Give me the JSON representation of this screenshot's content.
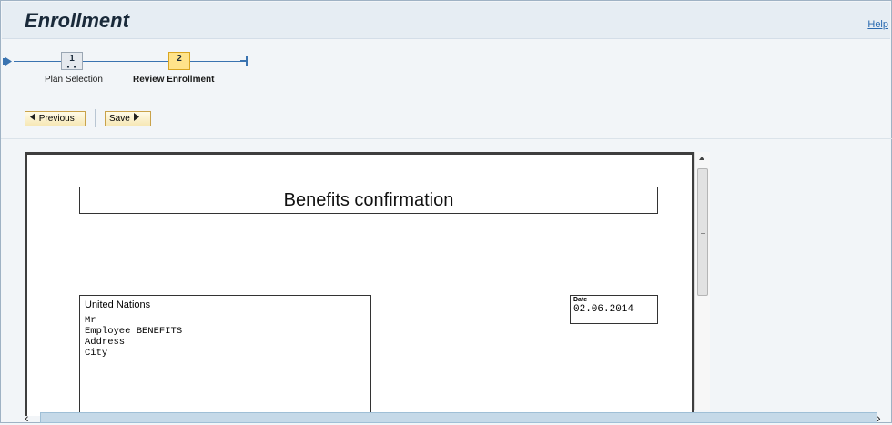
{
  "page": {
    "title": "Enrollment",
    "help_link": "Help"
  },
  "roadmap": {
    "steps": [
      {
        "number": "1",
        "label": "Plan Selection",
        "state": "completed"
      },
      {
        "number": "2",
        "label": "Review Enrollment",
        "state": "current"
      }
    ]
  },
  "toolbar": {
    "previous_label": "Previous",
    "save_label": "Save"
  },
  "document": {
    "title": "Benefits confirmation",
    "address": {
      "organization": "United Nations",
      "lines": [
        "Mr",
        "Employee BENEFITS",
        "Address",
        "City"
      ]
    },
    "date_label": "Date",
    "date_value": "02.06.2014"
  },
  "colors": {
    "accent": "#3a73b0",
    "current_step": "#ffe38a",
    "button_border": "#c9a24a",
    "hscroll_track": "#c5d9e8"
  }
}
